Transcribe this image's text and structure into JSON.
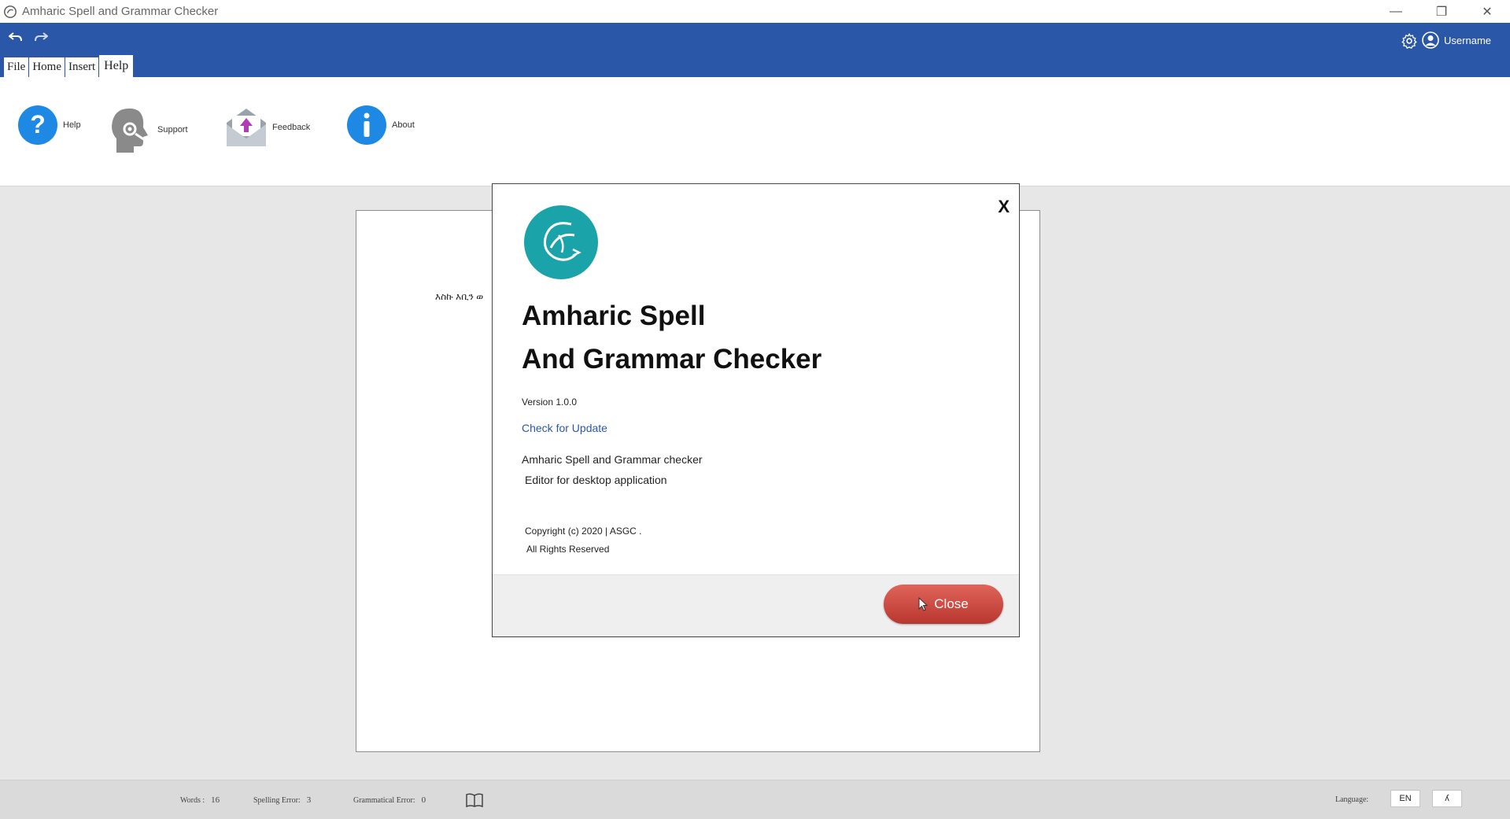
{
  "window": {
    "title": "Amharic Spell and Grammar Checker",
    "minimize": "—",
    "restore": "❐",
    "close": "✕"
  },
  "header": {
    "username": "Username",
    "accent_color": "#2b57a8"
  },
  "menu": {
    "tabs": [
      "File",
      "Home",
      "Insert",
      "Help"
    ],
    "active": "Help"
  },
  "ribbon": {
    "help": "Help",
    "support": "Support",
    "feedback": "Feedback",
    "about": "About"
  },
  "document": {
    "text": "እስኩ እቢን ወ"
  },
  "about_dialog": {
    "close_x": "X",
    "title_line1": "Amharic Spell",
    "title_line2": "And Grammar Checker",
    "version": "Version 1.0.0",
    "check_update": "Check for Update",
    "description_line1": "Amharic  Spell and Grammar checker",
    "description_line2": "Editor for desktop application",
    "copyright": "Copyright (c) 2020 | ASGC .",
    "rights": "All Rights Reserved",
    "close_button": "Close",
    "logo_color": "#1aa3a8",
    "close_button_color": "#c9463d"
  },
  "status": {
    "words_label": "Words :",
    "words_value": "16",
    "spelling_label": "Spelling Error:",
    "spelling_value": "3",
    "grammar_label": "Grammatical Error:",
    "grammar_value": "0",
    "language_label": "Language:",
    "lang_en": "EN",
    "lang_am": "ʎ"
  }
}
